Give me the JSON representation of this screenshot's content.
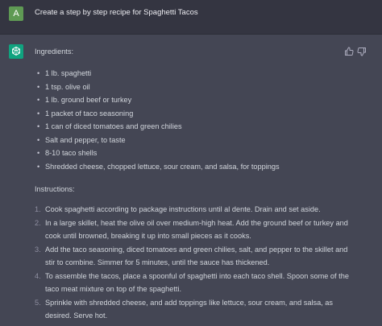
{
  "user": {
    "avatar_letter": "A",
    "avatar_color": "#5f9a54",
    "prompt": "Create a step by step recipe for Spaghetti Tacos"
  },
  "assistant": {
    "avatar_icon": "openai-logo-icon",
    "accent": "#10a37f",
    "ingredients_heading": "Ingredients:",
    "ingredients": [
      "1 lb. spaghetti",
      "1 tsp. olive oil",
      "1 lb. ground beef or turkey",
      "1 packet of taco seasoning",
      "1 can of diced tomatoes and green chilies",
      "Salt and pepper, to taste",
      "8-10 taco shells",
      "Shredded cheese, chopped lettuce, sour cream, and salsa, for toppings"
    ],
    "instructions_heading": "Instructions:",
    "instructions": [
      {
        "num": "1.",
        "text": "Cook spaghetti according to package instructions until al dente. Drain and set aside."
      },
      {
        "num": "2.",
        "text": "In a large skillet, heat the olive oil over medium-high heat. Add the ground beef or turkey and cook until browned, breaking it up into small pieces as it cooks."
      },
      {
        "num": "3.",
        "text": "Add the taco seasoning, diced tomatoes and green chilies, salt, and pepper to the skillet and stir to combine. Simmer for 5 minutes, until the sauce has thickened."
      },
      {
        "num": "4.",
        "text": "To assemble the tacos, place a spoonful of spaghetti into each taco shell. Spoon some of the taco meat mixture on top of the spaghetti."
      },
      {
        "num": "5.",
        "text": "Sprinkle with shredded cheese, and add toppings like lettuce, sour cream, and salsa, as desired. Serve hot."
      }
    ]
  },
  "feedback": {
    "thumbs_up_icon": "thumbs-up-icon",
    "thumbs_down_icon": "thumbs-down-icon"
  }
}
